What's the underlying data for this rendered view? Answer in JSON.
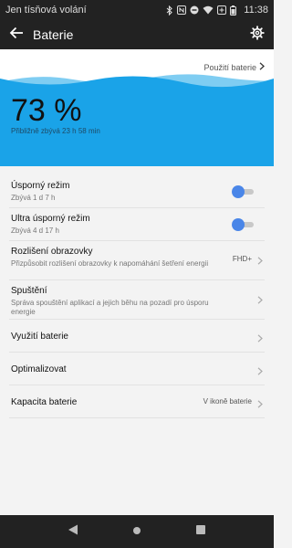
{
  "status_bar": {
    "carrier": "Jen tísňová volání",
    "time": "11:38",
    "icons": [
      "bluetooth-icon",
      "nfc-icon",
      "do-not-disturb-icon",
      "wifi-icon",
      "battery-saver-icon",
      "battery-icon"
    ]
  },
  "app_bar": {
    "title": "Baterie",
    "back_icon": "back-arrow-icon",
    "settings_icon": "gear-icon"
  },
  "hero": {
    "usage_link": "Použití baterie",
    "percent": "73 %",
    "level": 0.73,
    "remaining": "Přibližně zbývá 23 h 58 min",
    "wave_color": "#1aa3e8"
  },
  "settings": {
    "power_saving": {
      "title": "Úsporný režim",
      "subtitle": "Zbývá 1 d 7 h",
      "enabled": false
    },
    "ultra_power_saving": {
      "title": "Ultra úsporný režim",
      "subtitle": "Zbývá 4 d 17 h",
      "enabled": false
    },
    "screen_resolution": {
      "title": "Rozlišení obrazovky",
      "subtitle": "Přizpůsobit rozlišení obrazovky k napomáhání šetření energii",
      "value": "FHD+"
    },
    "launch": {
      "title": "Spuštění",
      "subtitle": "Správa spouštění aplikací a jejich běhu na pozadí pro úsporu energie"
    },
    "battery_usage": {
      "title": "Využití baterie"
    },
    "optimize": {
      "title": "Optimalizovat"
    },
    "battery_percentage": {
      "title": "Kapacita baterie",
      "value": "V ikoně baterie"
    }
  },
  "colors": {
    "accent": "#4a86e8",
    "wave": "#1aa3e8",
    "bar": "#222222"
  },
  "nav_bar": {
    "icons": [
      "back-triangle-icon",
      "home-circle-icon",
      "recents-square-icon"
    ]
  }
}
